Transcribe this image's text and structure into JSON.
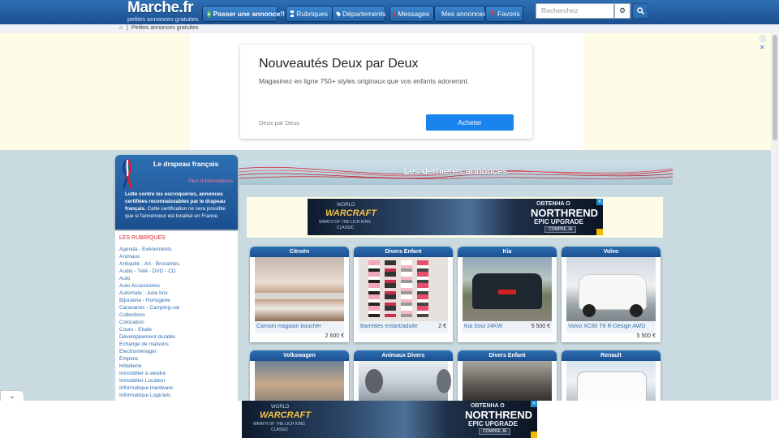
{
  "header": {
    "logo_name": "Marche.fr",
    "logo_tagline": "petites annonces gratuites",
    "post_button": "Passer une annonce!!",
    "nav": [
      "Rubriques",
      "Départements"
    ],
    "user_nav": [
      "Messages",
      "Mes annonces",
      "Favoris"
    ],
    "search_placeholder": "Recherchez"
  },
  "breadcrumb": {
    "current": "Petites annonces gratuites"
  },
  "top_ad": {
    "title": "Nouveautés Deux par Deux",
    "text": "Magasinez en ligne 750+ styles originaux que vos enfants adoreront.",
    "advertiser": "Deux par Deux",
    "cta": "Acheter"
  },
  "flag_box": {
    "title": "Le drapeau français",
    "more_link": "Plus d'informations",
    "text_bold": "Lutte contre les escroqueries, annonces certifiées reconnaissables par le drapeau français.",
    "text_rest": "Cette certification ne sera possible que si l'annonceur est localisé en France."
  },
  "sidebar": {
    "heading": "LES RUBRIQUES",
    "categories": [
      "Agenda - Evènements",
      "Animaux",
      "Antiquité - Art - Brocantes",
      "Audio - Télé - DVD - CD",
      "Auto",
      "Auto Accessoires",
      "Automate - Juke box",
      "Bijouterie - Horlogerie",
      "Caravanes - Camping-car",
      "Collections",
      "Colocation",
      "Cours - Etude",
      "Développement durable",
      "Echange de maisons",
      "Electroménager",
      "Emplois",
      "Hôtellerie",
      "Immobilier à vendre",
      "Immobilier Location",
      "Informatique Hardware",
      "Informatique Logiciels"
    ]
  },
  "main": {
    "heading": "Les dernières annonces"
  },
  "game_ad": {
    "logo_line1": "WORLD",
    "logo_line2": "WARCRAFT",
    "logo_line3": "WRATH OF THE LICH KING",
    "logo_line4": "CLASSIC",
    "line1": "OBTENHA O",
    "line2": "NORTHREND",
    "line3": "EPIC UPGRADE",
    "cta": "COMPRE JÁ"
  },
  "listings_row1": [
    {
      "category": "Citroën",
      "title": "Camion magasin boucherie épi...",
      "price": "2 600 €"
    },
    {
      "category": "Divers Enfant",
      "title": "Barrettes enfant/adulte",
      "price": "2 €"
    },
    {
      "category": "Kia",
      "title": "Kia Soul 24KW",
      "price": "5 500 €"
    },
    {
      "category": "Volvo",
      "title": "Volvo XC90 T8 R-Design AWD",
      "price": "5 500 €"
    }
  ],
  "listings_row2": [
    {
      "category": "Volkswagen"
    },
    {
      "category": "Animaux Divers"
    },
    {
      "category": "Divers Enfant"
    },
    {
      "category": "Renault"
    }
  ],
  "colors": {
    "header_blue": "#2d6fb3",
    "accent_red": "#d3222a",
    "link_blue": "#2f6fb3",
    "ad_cta": "#1a84ee"
  }
}
